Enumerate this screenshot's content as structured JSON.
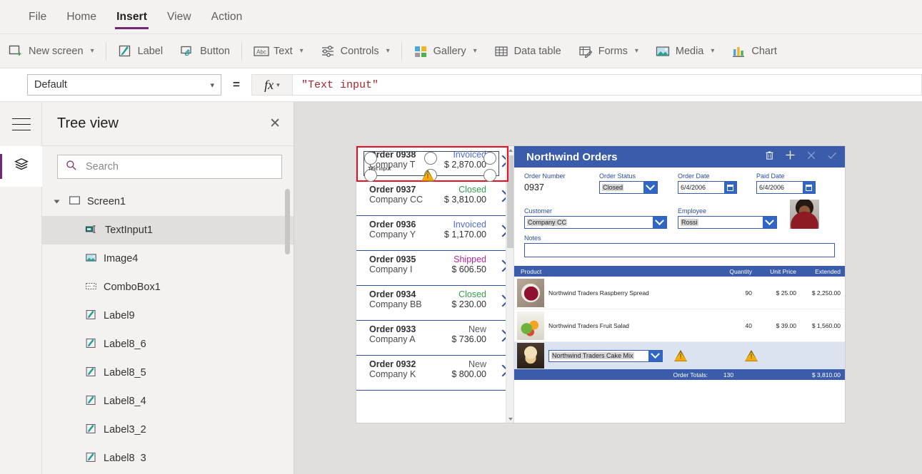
{
  "menubar": {
    "items": [
      {
        "label": "File",
        "active": false
      },
      {
        "label": "Home",
        "active": false
      },
      {
        "label": "Insert",
        "active": true
      },
      {
        "label": "View",
        "active": false
      },
      {
        "label": "Action",
        "active": false
      }
    ]
  },
  "ribbon": {
    "items": [
      {
        "label": "New screen",
        "icon": "new-screen-icon",
        "caret": true
      },
      {
        "label": "Label",
        "icon": "label-icon",
        "caret": false
      },
      {
        "label": "Button",
        "icon": "button-icon",
        "caret": false
      },
      {
        "label": "Text",
        "icon": "text-abc-icon",
        "caret": true
      },
      {
        "label": "Controls",
        "icon": "controls-sliders-icon",
        "caret": true
      },
      {
        "label": "Gallery",
        "icon": "gallery-icon",
        "caret": true
      },
      {
        "label": "Data table",
        "icon": "data-table-icon",
        "caret": false
      },
      {
        "label": "Forms",
        "icon": "forms-icon",
        "caret": true
      },
      {
        "label": "Media",
        "icon": "media-image-icon",
        "caret": true
      },
      {
        "label": "Chart",
        "icon": "chart-bar-icon",
        "caret": false
      }
    ]
  },
  "formula_bar": {
    "property": "Default",
    "equals": "=",
    "fx_label": "fx",
    "formula": "\"Text input\""
  },
  "tree_panel": {
    "title": "Tree view",
    "close_label": "✕",
    "search_placeholder": "Search",
    "search_value": "",
    "items": [
      {
        "label": "Screen1",
        "icon": "screen-icon",
        "level": 0,
        "selected": false,
        "expanded": true
      },
      {
        "label": "TextInput1",
        "icon": "textinput-icon",
        "level": 1,
        "selected": true
      },
      {
        "label": "Image4",
        "icon": "image-icon",
        "level": 1,
        "selected": false
      },
      {
        "label": "ComboBox1",
        "icon": "combobox-icon",
        "level": 1,
        "selected": false
      },
      {
        "label": "Label9",
        "icon": "label-icon",
        "level": 1,
        "selected": false
      },
      {
        "label": "Label8_6",
        "icon": "label-icon",
        "level": 1,
        "selected": false
      },
      {
        "label": "Label8_5",
        "icon": "label-icon",
        "level": 1,
        "selected": false
      },
      {
        "label": "Label8_4",
        "icon": "label-icon",
        "level": 1,
        "selected": false
      },
      {
        "label": "Label3_2",
        "icon": "label-icon",
        "level": 1,
        "selected": false
      },
      {
        "label": "Label8_3",
        "icon": "label-icon",
        "level": 1,
        "selected": false
      }
    ]
  },
  "canvas": {
    "selection": {
      "control_tag": "Text input",
      "outline_color": "#e81123"
    },
    "gallery": [
      {
        "order": "Order 0938",
        "company": "Company T",
        "status": "Invoiced",
        "status_color": "#4f6bd8",
        "amount": "$ 2,870.00"
      },
      {
        "order": "Order 0937",
        "company": "Company CC",
        "status": "Closed",
        "status_color": "#2e9e4a",
        "amount": "$ 3,810.00"
      },
      {
        "order": "Order 0936",
        "company": "Company Y",
        "status": "Invoiced",
        "status_color": "#4f6bd8",
        "amount": "$ 1,170.00"
      },
      {
        "order": "Order 0935",
        "company": "Company I",
        "status": "Shipped",
        "status_color": "#b4269b",
        "amount": "$ 606.50"
      },
      {
        "order": "Order 0934",
        "company": "Company BB",
        "status": "Closed",
        "status_color": "#2e9e4a",
        "amount": "$ 230.00"
      },
      {
        "order": "Order 0933",
        "company": "Company A",
        "status": "New",
        "status_color": "#5a5a5a",
        "amount": "$ 736.00"
      },
      {
        "order": "Order 0932",
        "company": "Company K",
        "status": "New",
        "status_color": "#5a5a5a",
        "amount": "$ 800.00"
      }
    ],
    "detail": {
      "title": "Northwind Orders",
      "header_icons": [
        "trash-icon",
        "plus-icon",
        "close-x-icon",
        "check-icon"
      ],
      "fields": {
        "order_number_label": "Order Number",
        "order_number_value": "0937",
        "order_status_label": "Order Status",
        "order_status_value": "Closed",
        "order_date_label": "Order Date",
        "order_date_value": "6/4/2006",
        "paid_date_label": "Paid Date",
        "paid_date_value": "6/4/2006",
        "customer_label": "Customer",
        "customer_value": "Company CC",
        "employee_label": "Employee",
        "employee_value": "Rossi",
        "notes_label": "Notes",
        "notes_value": ""
      },
      "product_table": {
        "headers": [
          "Product",
          "Quantity",
          "Unit Price",
          "Extended"
        ],
        "rows": [
          {
            "name": "Northwind Traders Raspberry Spread",
            "quantity": "90",
            "unit_price": "$ 25.00",
            "extended": "$ 2,250.00",
            "thumb": "raspberry"
          },
          {
            "name": "Northwind Traders Fruit Salad",
            "quantity": "40",
            "unit_price": "$ 39.00",
            "extended": "$ 1,560.00",
            "thumb": "salad"
          }
        ],
        "new_row": {
          "product": "Northwind Traders Cake Mix",
          "thumb": "cake"
        },
        "totals_label": "Order Totals:",
        "totals_quantity": "130",
        "totals_extended": "$ 3,810.00"
      }
    }
  },
  "colors": {
    "accent_purple": "#742774",
    "form_blue": "#3b5bab",
    "combo_blue": "#2f67c4",
    "selection_red": "#e81123",
    "warning_amber": "#f0a300",
    "formula_red": "#a4262c"
  }
}
